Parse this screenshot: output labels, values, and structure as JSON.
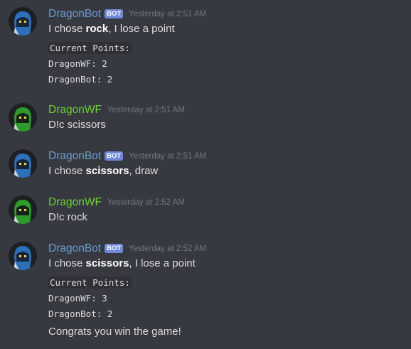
{
  "messages": [
    {
      "author": "DragonBot",
      "bot_tag": "BOT",
      "timestamp": "Yesterday at 2:51 AM",
      "line_pre": "I chose ",
      "line_bold": "rock",
      "line_post": ", I lose a point",
      "points_header": "Current Points:",
      "points": [
        "DragonWF: 2",
        "DragonBot: 2"
      ]
    },
    {
      "author": "DragonWF",
      "timestamp": "Yesterday at 2:51 AM",
      "text": "D!c scissors"
    },
    {
      "author": "DragonBot",
      "bot_tag": "BOT",
      "timestamp": "Yesterday at 2:51 AM",
      "line_pre": "I chose ",
      "line_bold": "scissors",
      "line_post": ", draw"
    },
    {
      "author": "DragonWF",
      "timestamp": "Yesterday at 2:52 AM",
      "text": "D!c rock"
    },
    {
      "author": "DragonBot",
      "bot_tag": "BOT",
      "timestamp": "Yesterday at 2:52 AM",
      "line_pre": "I chose ",
      "line_bold": "scissors",
      "line_post": ", I lose a point",
      "points_header": "Current Points:",
      "points": [
        "DragonWF: 3",
        "DragonBot: 2"
      ],
      "final_text": "Congrats you win the game!"
    }
  ],
  "colors": {
    "background": "#36393f",
    "bot_name": "#6f9bd0",
    "user_name": "#6ed12f",
    "bot_tag": "#7289da",
    "timestamp": "#72767d",
    "text": "#dcddde"
  },
  "icons": {
    "bot_avatar": "blue-dragon-avatar-icon",
    "user_avatar": "green-dragon-avatar-icon"
  }
}
